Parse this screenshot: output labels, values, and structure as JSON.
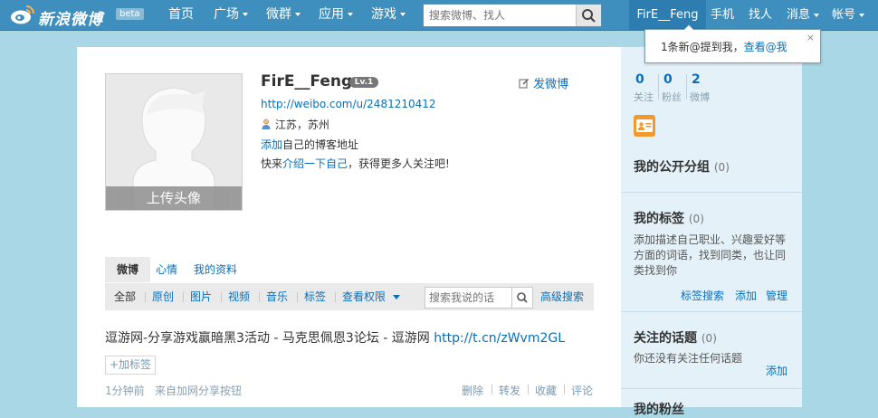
{
  "colors": {
    "topbar": "#3e8fbd",
    "accent": "#0a6fb8",
    "page_bg": "#a9d7e6",
    "sidebar_bg": "#e4f1f8"
  },
  "topbar": {
    "logo_text": "新浪微博",
    "beta": "beta",
    "nav": [
      {
        "label": "首页",
        "dropdown": false
      },
      {
        "label": "广场",
        "dropdown": true
      },
      {
        "label": "微群",
        "dropdown": true
      },
      {
        "label": "应用",
        "dropdown": true
      },
      {
        "label": "游戏",
        "dropdown": true
      }
    ],
    "search_placeholder": "搜索微博、找人",
    "username": "FirE__Feng",
    "right_nav": [
      {
        "label": "手机",
        "dropdown": false
      },
      {
        "label": "找人",
        "dropdown": false
      },
      {
        "label": "消息",
        "dropdown": true
      },
      {
        "label": "帐号",
        "dropdown": true
      }
    ]
  },
  "notification": {
    "text": "1条新@提到我，",
    "link": "查看@我",
    "close": "×"
  },
  "profile": {
    "name": "FirE__Feng",
    "badge": "Lv.1",
    "post_button": "发微博",
    "url": "http://weibo.com/u/2481210412",
    "location": "江苏，苏州",
    "blog_link": "添加",
    "blog_text": "自己的博客地址",
    "intro_prefix": "快来",
    "intro_link": "介绍一下自己",
    "intro_suffix": "，获得更多人关注吧!",
    "upload_avatar": "上传头像"
  },
  "tabs": [
    "微博",
    "心情",
    "我的资料"
  ],
  "filters": [
    "全部",
    "原创",
    "图片",
    "视频",
    "音乐",
    "标签",
    "查看权限"
  ],
  "filter_search_placeholder": "搜索我说的话",
  "advanced_search": "高级搜索",
  "post": {
    "text": "逗游网-分享游戏赢暗黑3活动 - 马克思佩恩3论坛 - 逗游网 ",
    "link": "http://t.cn/zWvm2GL",
    "add_tag": "+加标签",
    "time": "1分钟前",
    "source": "来自加网分享按钮",
    "actions": [
      "删除",
      "转发",
      "收藏",
      "评论"
    ]
  },
  "sidebar": {
    "stats": [
      {
        "num": "0",
        "label": "关注"
      },
      {
        "num": "0",
        "label": "粉丝"
      },
      {
        "num": "2",
        "label": "微博"
      }
    ],
    "groups_title": "我的公开分组",
    "groups_count": "(0)",
    "tags_title": "我的标签",
    "tags_count": "(0)",
    "tags_desc_1": "添加描述自己职业、兴趣爱好等",
    "tags_desc_2": "方面的词语，找到同类，也让同",
    "tags_desc_3": "类找到你",
    "tags_actions": [
      "标签搜索",
      "添加",
      "管理"
    ],
    "topics_title": "关注的话题",
    "topics_count": "(0)",
    "topics_desc": "你还没有关注任何话题",
    "topics_add": "添加",
    "cut_title": "我的粉丝"
  }
}
